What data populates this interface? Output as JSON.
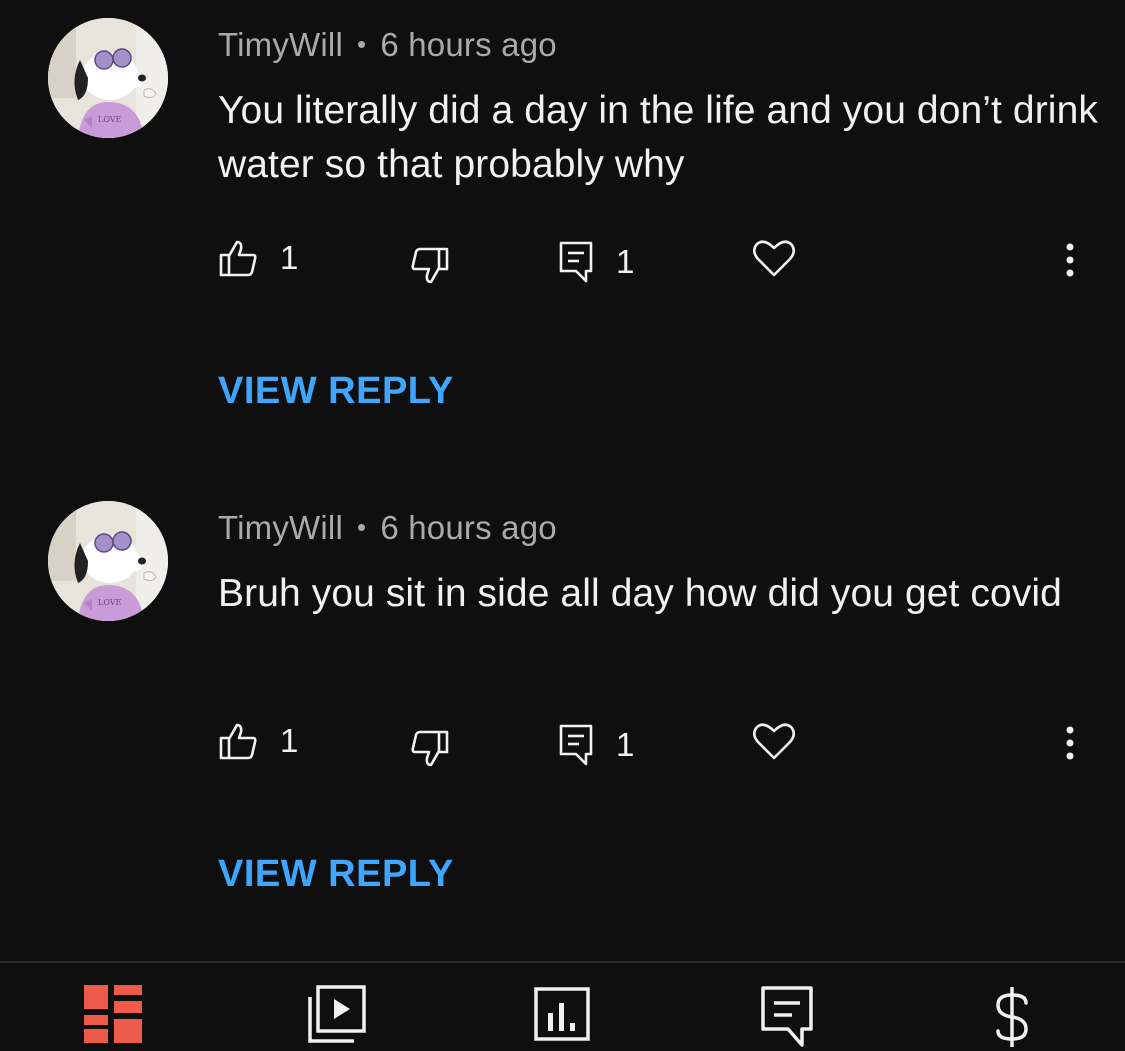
{
  "colors": {
    "background": "#0f0f0f",
    "text_primary": "#f1f1f1",
    "text_secondary": "#aaaaaa",
    "link_blue": "#3ea6ff",
    "active_nav": "#ef5b4b"
  },
  "comments": [
    {
      "author": "TimyWill",
      "separator": "•",
      "time": "6 hours ago",
      "text": "You literally did a day in the life and you don’t drink water so that probably why",
      "like_count": "1",
      "reply_count": "1",
      "view_reply_label": "VIEW REPLY",
      "avatar_icon": "snoopy-avatar-icon"
    },
    {
      "author": "TimyWill",
      "separator": "•",
      "time": "6 hours ago",
      "text": "Bruh you sit in side all day how did you get covid",
      "like_count": "1",
      "reply_count": "1",
      "view_reply_label": "VIEW REPLY",
      "avatar_icon": "snoopy-avatar-icon"
    }
  ],
  "bottom_nav": [
    {
      "icon": "dashboard-icon",
      "active": true
    },
    {
      "icon": "content-icon",
      "active": false
    },
    {
      "icon": "analytics-icon",
      "active": false
    },
    {
      "icon": "comments-icon",
      "active": false
    },
    {
      "icon": "earn-icon",
      "active": false
    }
  ]
}
